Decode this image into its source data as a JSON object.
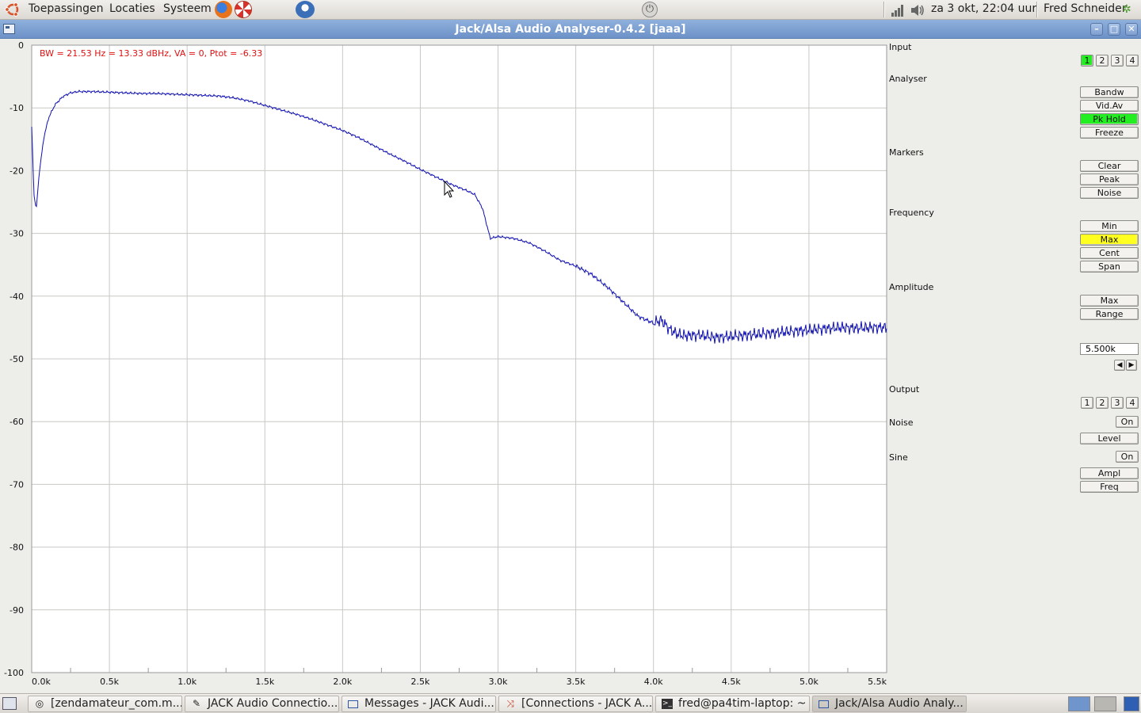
{
  "top_panel": {
    "menus": [
      "Toepassingen",
      "Locaties",
      "Systeem"
    ],
    "clock": "za  3 okt, 22:04 uur",
    "user": "Fred Schneider"
  },
  "window": {
    "title": "Jack/Alsa Audio Analyser-0.4.2  [jaaa]",
    "buttons": {
      "minimize": "–",
      "maximize": "□",
      "close": "✕"
    }
  },
  "plot": {
    "status_line": "BW = 21.53 Hz = 13.33 dBHz, VA = 0, Ptot = -6.33",
    "trace_color": "#1010b0",
    "grid_color": "#c8c8c4"
  },
  "chart_data": {
    "type": "line",
    "xlabel": "",
    "ylabel": "",
    "x_unit": "Hz",
    "y_unit": "dB",
    "xlim": [
      0,
      5500
    ],
    "ylim": [
      -100,
      0
    ],
    "x_ticks": [
      "0.0k",
      "0.5k",
      "1.0k",
      "1.5k",
      "2.0k",
      "2.5k",
      "3.0k",
      "3.5k",
      "4.0k",
      "4.5k",
      "5.0k",
      "5.5k"
    ],
    "y_ticks": [
      "0",
      "-10",
      "-20",
      "-30",
      "-40",
      "-50",
      "-60",
      "-70",
      "-80",
      "-90",
      "-100"
    ],
    "grid": true,
    "series": [
      {
        "x": [
          0,
          15,
          30,
          50,
          80,
          110,
          150,
          200,
          250,
          300,
          400,
          500,
          600,
          700,
          800,
          900,
          1000,
          1100,
          1200,
          1300,
          1400,
          1500,
          1600,
          1700,
          1800,
          1900,
          2000,
          2100,
          2200,
          2300,
          2400,
          2500,
          2600,
          2700,
          2800,
          2850,
          2900,
          2950,
          3000,
          3100,
          3200,
          3300,
          3400,
          3500,
          3600,
          3700,
          3800,
          3900,
          4000,
          4050,
          4100,
          4150,
          4200,
          4300,
          4400,
          4500,
          4600,
          4700,
          4800,
          4900,
          5000,
          5100,
          5200,
          5300,
          5400,
          5500
        ],
        "y": [
          -13,
          -24,
          -26,
          -20,
          -14.5,
          -11.5,
          -9.5,
          -8.2,
          -7.6,
          -7.4,
          -7.4,
          -7.5,
          -7.6,
          -7.7,
          -7.7,
          -7.8,
          -7.9,
          -8.0,
          -8.1,
          -8.4,
          -8.9,
          -9.6,
          -10.3,
          -11.0,
          -11.8,
          -12.7,
          -13.6,
          -14.7,
          -16.0,
          -17.3,
          -18.5,
          -19.8,
          -21.0,
          -22.2,
          -23.2,
          -23.8,
          -26.0,
          -30.8,
          -30.5,
          -30.8,
          -31.5,
          -32.8,
          -34.3,
          -35.2,
          -36.5,
          -38.5,
          -40.8,
          -43.2,
          -44.3,
          -43.8,
          -45.2,
          -46.0,
          -46.3,
          -46.2,
          -46.6,
          -46.4,
          -46.2,
          -46.0,
          -45.8,
          -45.6,
          -45.4,
          -45.2,
          -45.0,
          -45.1,
          -45.0,
          -45.0
        ]
      }
    ]
  },
  "controls": {
    "input": {
      "label": "Input",
      "buttons": [
        "1",
        "2",
        "3",
        "4"
      ],
      "active": "1"
    },
    "analyser": {
      "label": "Analyser",
      "buttons": [
        "Bandw",
        "Vid.Av",
        "Pk Hold",
        "Freeze"
      ],
      "active": "Pk Hold"
    },
    "markers": {
      "label": "Markers",
      "buttons": [
        "Clear",
        "Peak",
        "Noise"
      ]
    },
    "frequency": {
      "label": "Frequency",
      "buttons": [
        "Min",
        "Max",
        "Cent",
        "Span"
      ],
      "active": "Max"
    },
    "amplitude": {
      "label": "Amplitude",
      "buttons": [
        "Max",
        "Range"
      ]
    },
    "value_field": "5.500k",
    "output": {
      "label": "Output",
      "buttons": [
        "1",
        "2",
        "3",
        "4"
      ]
    },
    "noise": {
      "label": "Noise",
      "on": "On",
      "level": "Level"
    },
    "sine": {
      "label": "Sine",
      "on": "On",
      "ampl": "Ampl",
      "freq": "Freq"
    },
    "colors": {
      "active_green": "#22ee22",
      "active_yellow": "#ffff20"
    }
  },
  "taskbar": {
    "tasks": [
      {
        "label": "[zendamateur_com.m...",
        "icon": "browser-icon"
      },
      {
        "label": "JACK Audio Connectio...",
        "icon": "pen-icon"
      },
      {
        "label": "Messages - JACK Audi...",
        "icon": "window-icon"
      },
      {
        "label": "[Connections - JACK A...",
        "icon": "connections-icon"
      },
      {
        "label": "fred@pa4tim-laptop: ~",
        "icon": "terminal-icon"
      },
      {
        "label": "Jack/Alsa Audio Analy...",
        "icon": "window-icon"
      }
    ]
  }
}
